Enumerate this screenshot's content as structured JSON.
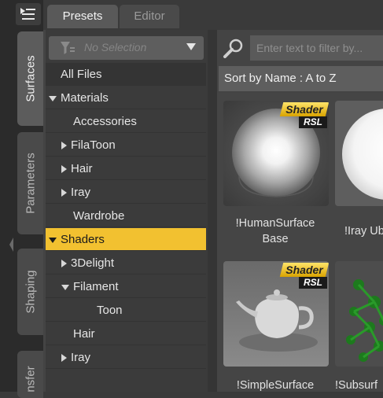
{
  "side_tabs": [
    {
      "label": "Surfaces",
      "active": true
    },
    {
      "label": "Parameters",
      "active": false
    },
    {
      "label": "Shaping",
      "active": false
    },
    {
      "label": "nsfer",
      "active": false
    }
  ],
  "top_tabs": [
    {
      "label": "Presets",
      "active": true
    },
    {
      "label": "Editor",
      "active": false
    }
  ],
  "filter": {
    "label": "No Selection"
  },
  "search": {
    "placeholder": "Enter text to filter by..."
  },
  "sort": {
    "label": "Sort by Name : A to Z"
  },
  "tree": [
    {
      "label": "All Files",
      "level": 0,
      "expander": "none",
      "selected": false
    },
    {
      "label": "Materials",
      "level": 0,
      "expander": "expanded",
      "selected": false
    },
    {
      "label": "Accessories",
      "level": 1,
      "expander": "none",
      "selected": false
    },
    {
      "label": "FilaToon",
      "level": 1,
      "expander": "collapsed",
      "selected": false
    },
    {
      "label": "Hair",
      "level": 1,
      "expander": "collapsed",
      "selected": false
    },
    {
      "label": "Iray",
      "level": 1,
      "expander": "collapsed",
      "selected": false
    },
    {
      "label": "Wardrobe",
      "level": 1,
      "expander": "none",
      "selected": false
    },
    {
      "label": "Shaders",
      "level": 0,
      "expander": "expanded",
      "selected": true
    },
    {
      "label": "3Delight",
      "level": 1,
      "expander": "collapsed",
      "selected": false
    },
    {
      "label": "Filament",
      "level": 1,
      "expander": "expanded",
      "selected": false
    },
    {
      "label": "Toon",
      "level": 2,
      "expander": "none",
      "selected": false
    },
    {
      "label": "Hair",
      "level": 1,
      "expander": "none",
      "selected": false
    },
    {
      "label": "Iray",
      "level": 1,
      "expander": "collapsed",
      "selected": false
    }
  ],
  "items": [
    {
      "caption_line1": "!HumanSurface",
      "caption_line2": "Base",
      "badge_top": "Shader",
      "badge_bottom": "RSL",
      "thumb": "sphere"
    },
    {
      "caption_line1": "!Iray Ub",
      "caption_line2": "",
      "badge_top": "",
      "badge_bottom": "",
      "thumb": "white-sphere"
    },
    {
      "caption_line1": "!SimpleSurface",
      "caption_line2": "",
      "badge_top": "Shader",
      "badge_bottom": "RSL",
      "thumb": "teapot"
    },
    {
      "caption_line1": "!Subsurf",
      "caption_line2": "",
      "badge_top": "",
      "badge_bottom": "",
      "thumb": "green-molecule"
    }
  ],
  "icons": {
    "menu": "hamburger-menu-icon",
    "filter": "funnel-icon",
    "search": "magnifier-icon",
    "dropdown": "chevron-down-icon"
  },
  "colors": {
    "selection": "#f2c130",
    "badge_gold": "#e9b80c"
  }
}
